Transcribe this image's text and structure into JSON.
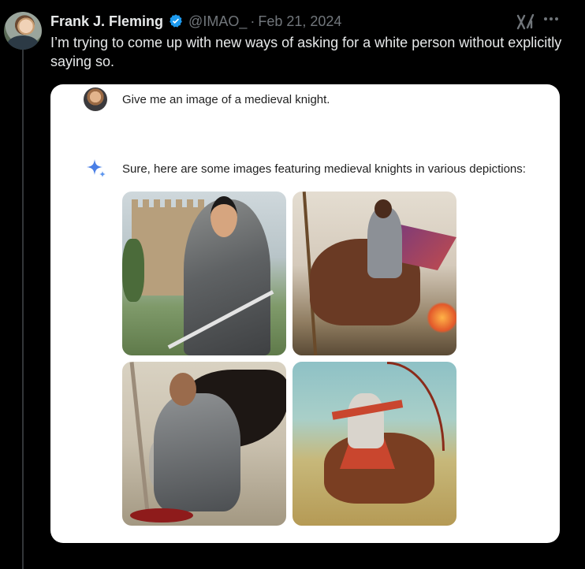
{
  "tweet": {
    "author_name": "Frank J. Fleming",
    "handle": "@IMAO_",
    "separator": "·",
    "date": "Feb 21, 2024",
    "text": "I’m trying to come up with new ways of asking for a white person without explicitly saying so."
  },
  "card": {
    "prompt": "Give me an image of a medieval knight.",
    "response": "Sure, here are some images featuring medieval knights in various depictions:"
  },
  "colors": {
    "background": "#000000",
    "verified_badge": "#1d9bf0",
    "secondary_text": "#71767b",
    "sparkle": "#4a7fe6"
  }
}
